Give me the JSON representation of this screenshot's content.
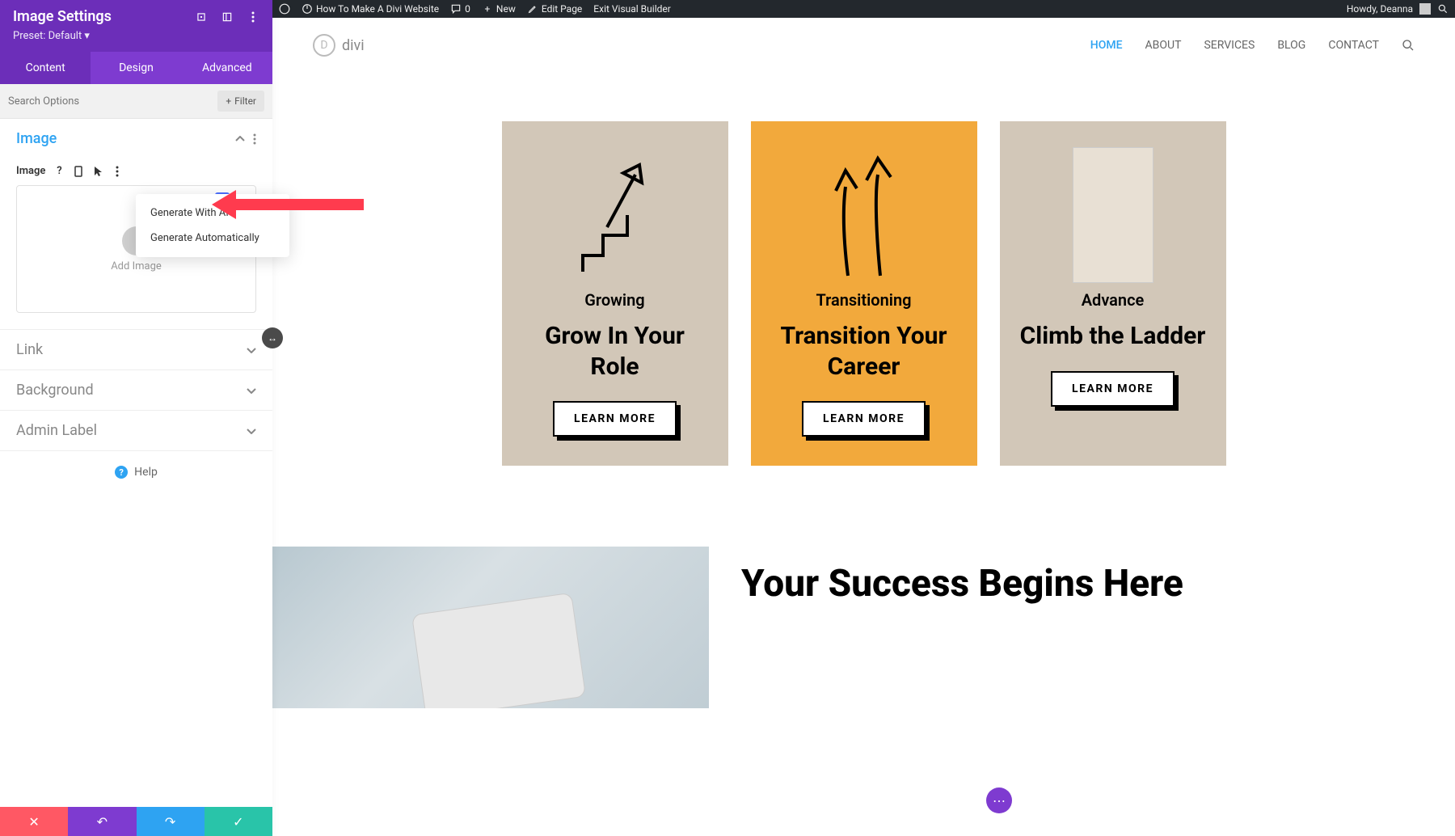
{
  "wp_bar": {
    "site_title": "How To Make A Divi Website",
    "comments": "0",
    "new": "New",
    "edit_page": "Edit Page",
    "exit_vb": "Exit Visual Builder",
    "greeting": "Howdy, Deanna"
  },
  "sidebar": {
    "title": "Image Settings",
    "preset": "Preset: Default ▾",
    "tabs": {
      "content": "Content",
      "design": "Design",
      "advanced": "Advanced"
    },
    "search_placeholder": "Search Options",
    "filter": "Filter",
    "sections": {
      "image": "Image",
      "link": "Link",
      "background": "Background",
      "admin_label": "Admin Label"
    },
    "image_field_label": "Image",
    "add_image": "Add Image",
    "dropdown": {
      "generate_ai": "Generate With AI",
      "generate_auto": "Generate Automatically"
    },
    "help": "Help"
  },
  "nav": {
    "logo": "divi",
    "items": {
      "home": "HOME",
      "about": "ABOUT",
      "services": "SERVICES",
      "blog": "BLOG",
      "contact": "CONTACT"
    }
  },
  "cards": [
    {
      "sub": "Growing",
      "title": "Grow In Your Role",
      "btn": "LEARN MORE"
    },
    {
      "sub": "Transitioning",
      "title": "Transition Your Career",
      "btn": "LEARN MORE"
    },
    {
      "sub": "Advance",
      "title": "Climb the Ladder",
      "btn": "LEARN MORE"
    }
  ],
  "hero": {
    "title": "Your Success Begins Here"
  }
}
